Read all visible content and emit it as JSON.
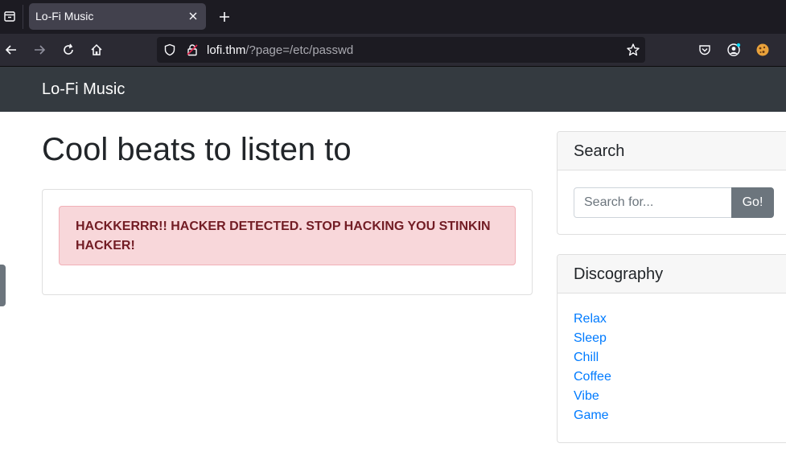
{
  "browser": {
    "tab_title": "Lo-Fi Music",
    "url_host": "lofi.thm",
    "url_path": "/?page=/etc/passwd"
  },
  "site": {
    "brand": "Lo-Fi Music",
    "heading": "Cool beats to listen to",
    "alert_message": "HACKKERRR!! HACKER DETECTED. STOP HACKING YOU STINKIN HACKER!"
  },
  "sidebar": {
    "search": {
      "title": "Search",
      "placeholder": "Search for...",
      "button_label": "Go!"
    },
    "discography": {
      "title": "Discography",
      "items": [
        "Relax",
        "Sleep",
        "Chill",
        "Coffee",
        "Vibe",
        "Game"
      ]
    }
  },
  "colors": {
    "navbar_dark": "#343a40",
    "alert_bg": "#f8d7da",
    "alert_text": "#721c24",
    "link": "#007bff",
    "button_secondary": "#6c757d"
  }
}
